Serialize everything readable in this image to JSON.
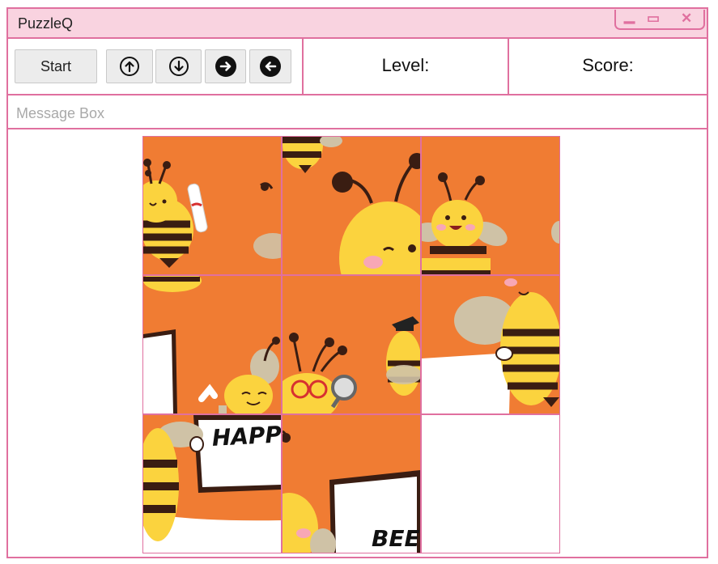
{
  "window": {
    "title": "PuzzleQ",
    "controls": {
      "minimize": "▁",
      "maximize": "▭",
      "close": "✕"
    }
  },
  "toolbar": {
    "start_label": "Start",
    "arrows": [
      "arrow-up-icon",
      "arrow-down-icon",
      "arrow-right-icon",
      "arrow-left-icon"
    ],
    "level_label": "Level:",
    "score_label": "Score:"
  },
  "message": {
    "placeholder": "Message Box"
  },
  "board": {
    "rows": 3,
    "cols": 3,
    "tiles": [
      {
        "row": 0,
        "col": 0,
        "content": "bee-with-scroll",
        "text": ""
      },
      {
        "row": 0,
        "col": 1,
        "content": "bee-winking-face",
        "text": ""
      },
      {
        "row": 0,
        "col": 2,
        "content": "bee-smiling",
        "text": ""
      },
      {
        "row": 1,
        "col": 0,
        "content": "bee-waving-sign",
        "text": ""
      },
      {
        "row": 1,
        "col": 1,
        "content": "bee-glasses-magnifier",
        "text": ""
      },
      {
        "row": 1,
        "col": 2,
        "content": "bee-holding-sign",
        "text": ""
      },
      {
        "row": 2,
        "col": 0,
        "content": "sign-happ",
        "text": "HAPP"
      },
      {
        "row": 2,
        "col": 1,
        "content": "sign-bee",
        "text": "BEE"
      },
      {
        "row": 2,
        "col": 2,
        "content": "empty",
        "text": ""
      }
    ],
    "colors": {
      "orange": "#f07c33",
      "yellow": "#fbd33e",
      "brown": "#3a1d12",
      "border": "#e0709f",
      "wing": "#cfc2a6"
    }
  }
}
